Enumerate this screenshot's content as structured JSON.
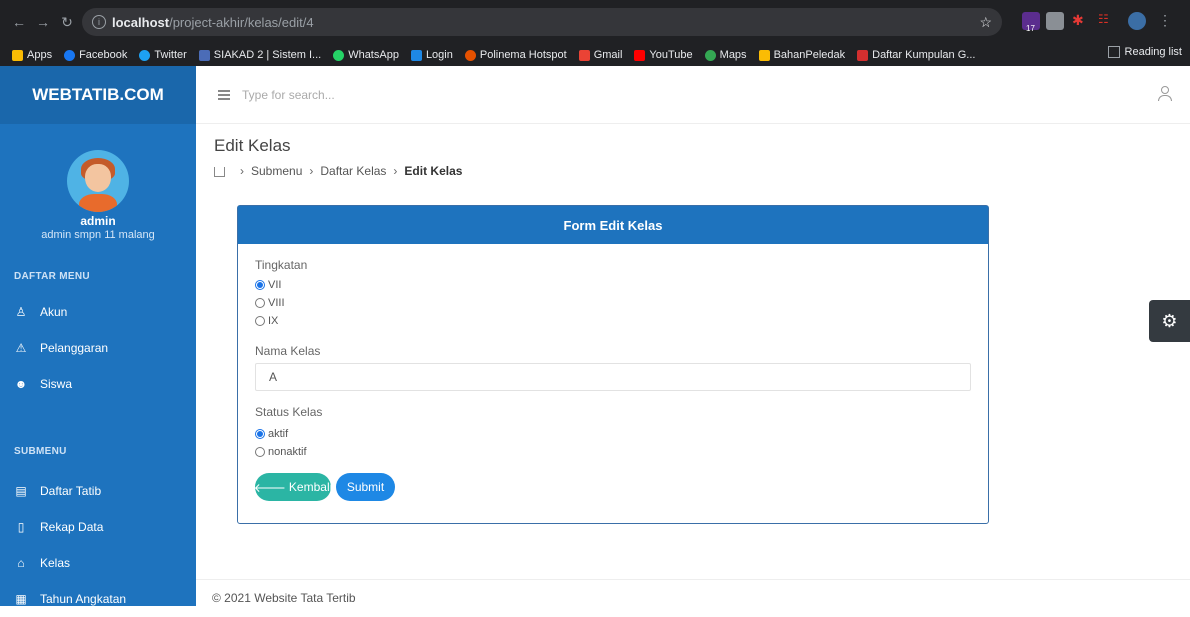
{
  "browser": {
    "url_host": "localhost",
    "url_path": "/project-akhir/kelas/edit/4",
    "bookmarks": [
      "Apps",
      "Facebook",
      "Twitter",
      "SIAKAD 2 | Sistem I...",
      "WhatsApp",
      "Login",
      "Polinema Hotspot",
      "Gmail",
      "YouTube",
      "Maps",
      "BahanPeledak",
      "Daftar Kumpulan G..."
    ],
    "reading_list": "Reading list",
    "ext_badge": "17"
  },
  "sidebar": {
    "brand": "WEBTATIB.COM",
    "user_name": "admin",
    "user_sub": "admin smpn 11 malang",
    "section_menu": "DAFTAR MENU",
    "menu": [
      "Akun",
      "Pelanggaran",
      "Siswa"
    ],
    "section_sub": "SUBMENU",
    "submenu": [
      "Daftar Tatib",
      "Rekap Data",
      "Kelas",
      "Tahun Angkatan"
    ]
  },
  "topbar": {
    "search_placeholder": "Type for search..."
  },
  "page": {
    "title": "Edit Kelas",
    "breadcrumb": [
      "Submenu",
      "Daftar Kelas",
      "Edit Kelas"
    ]
  },
  "form": {
    "header": "Form Edit Kelas",
    "tingkatan_label": "Tingkatan",
    "tingkatan_options": [
      "VII",
      "VIII",
      "IX"
    ],
    "tingkatan_selected": "VII",
    "nama_label": "Nama Kelas",
    "nama_value": "A",
    "status_label": "Status Kelas",
    "status_options": [
      "aktif",
      "nonaktif"
    ],
    "status_selected": "aktif",
    "back_label": "Kembali",
    "submit_label": "Submit"
  },
  "footer": {
    "text": "© 2021 Website Tata Tertib"
  },
  "colors": {
    "sidebar": "#1e73be",
    "header": "#1e73be",
    "back": "#2bb5a4",
    "submit": "#1e88e5"
  }
}
